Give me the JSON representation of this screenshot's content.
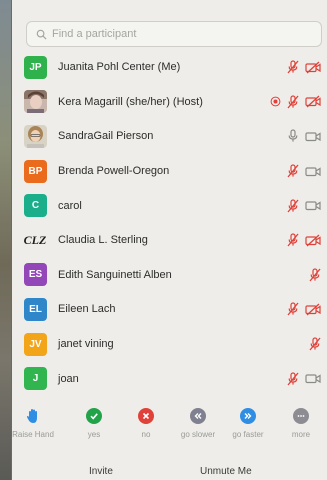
{
  "search": {
    "placeholder": "Find a participant"
  },
  "colors": {
    "muted_red": "#e0413a",
    "icon_gray": "#8a8a86",
    "jp": "#2fb14b",
    "bp": "#ea6b1c",
    "c": "#1bae8a",
    "es": "#9346b8",
    "el": "#2f86c9",
    "jv": "#f3a51a",
    "j": "#31b54e"
  },
  "participants": [
    {
      "initials": "JP",
      "avatar": "initials",
      "color": "#2fb14b",
      "name": "Juanita Pohl Center (Me)",
      "recording": false,
      "mic": "muted",
      "video": "off"
    },
    {
      "initials": "",
      "avatar": "photo-kera",
      "color": "",
      "name": "Kera Magarill (she/her) (Host)",
      "recording": true,
      "mic": "muted",
      "video": "off"
    },
    {
      "initials": "",
      "avatar": "photo-sandra",
      "color": "",
      "name": "SandraGail Pierson",
      "recording": false,
      "mic": "on",
      "video": "on"
    },
    {
      "initials": "BP",
      "avatar": "initials",
      "color": "#ea6b1c",
      "name": "Brenda Powell-Oregon",
      "recording": false,
      "mic": "muted",
      "video": "on"
    },
    {
      "initials": "C",
      "avatar": "initials",
      "color": "#1bae8a",
      "name": "carol",
      "recording": false,
      "mic": "muted",
      "video": "on"
    },
    {
      "initials": "CLZ",
      "avatar": "logo",
      "color": "",
      "name": "Claudia L. Sterling",
      "recording": false,
      "mic": "muted",
      "video": "off"
    },
    {
      "initials": "ES",
      "avatar": "initials",
      "color": "#9346b8",
      "name": "Edith Sanguinetti Alben",
      "recording": false,
      "mic": "muted",
      "video": "none"
    },
    {
      "initials": "EL",
      "avatar": "initials",
      "color": "#2f86c9",
      "name": "Eileen Lach",
      "recording": false,
      "mic": "muted",
      "video": "off"
    },
    {
      "initials": "JV",
      "avatar": "initials",
      "color": "#f3a51a",
      "name": "janet vining",
      "recording": false,
      "mic": "muted",
      "video": "none"
    },
    {
      "initials": "J",
      "avatar": "initials",
      "color": "#31b54e",
      "name": "joan",
      "recording": false,
      "mic": "muted",
      "video": "on"
    }
  ],
  "reactions": [
    {
      "label": "Raise Hand",
      "icon": "raise-hand-icon",
      "color": "#2f8de4"
    },
    {
      "label": "yes",
      "icon": "check-icon",
      "color": "#22a34a"
    },
    {
      "label": "no",
      "icon": "x-icon",
      "color": "#e0413a"
    },
    {
      "label": "go slower",
      "icon": "rewind-icon",
      "color": "#7f8190"
    },
    {
      "label": "go faster",
      "icon": "fast-forward-icon",
      "color": "#2f8de4"
    },
    {
      "label": "more",
      "icon": "more-icon",
      "color": "#8c8c92"
    }
  ],
  "footer": {
    "invite": "Invite",
    "unmute_me": "Unmute Me"
  }
}
